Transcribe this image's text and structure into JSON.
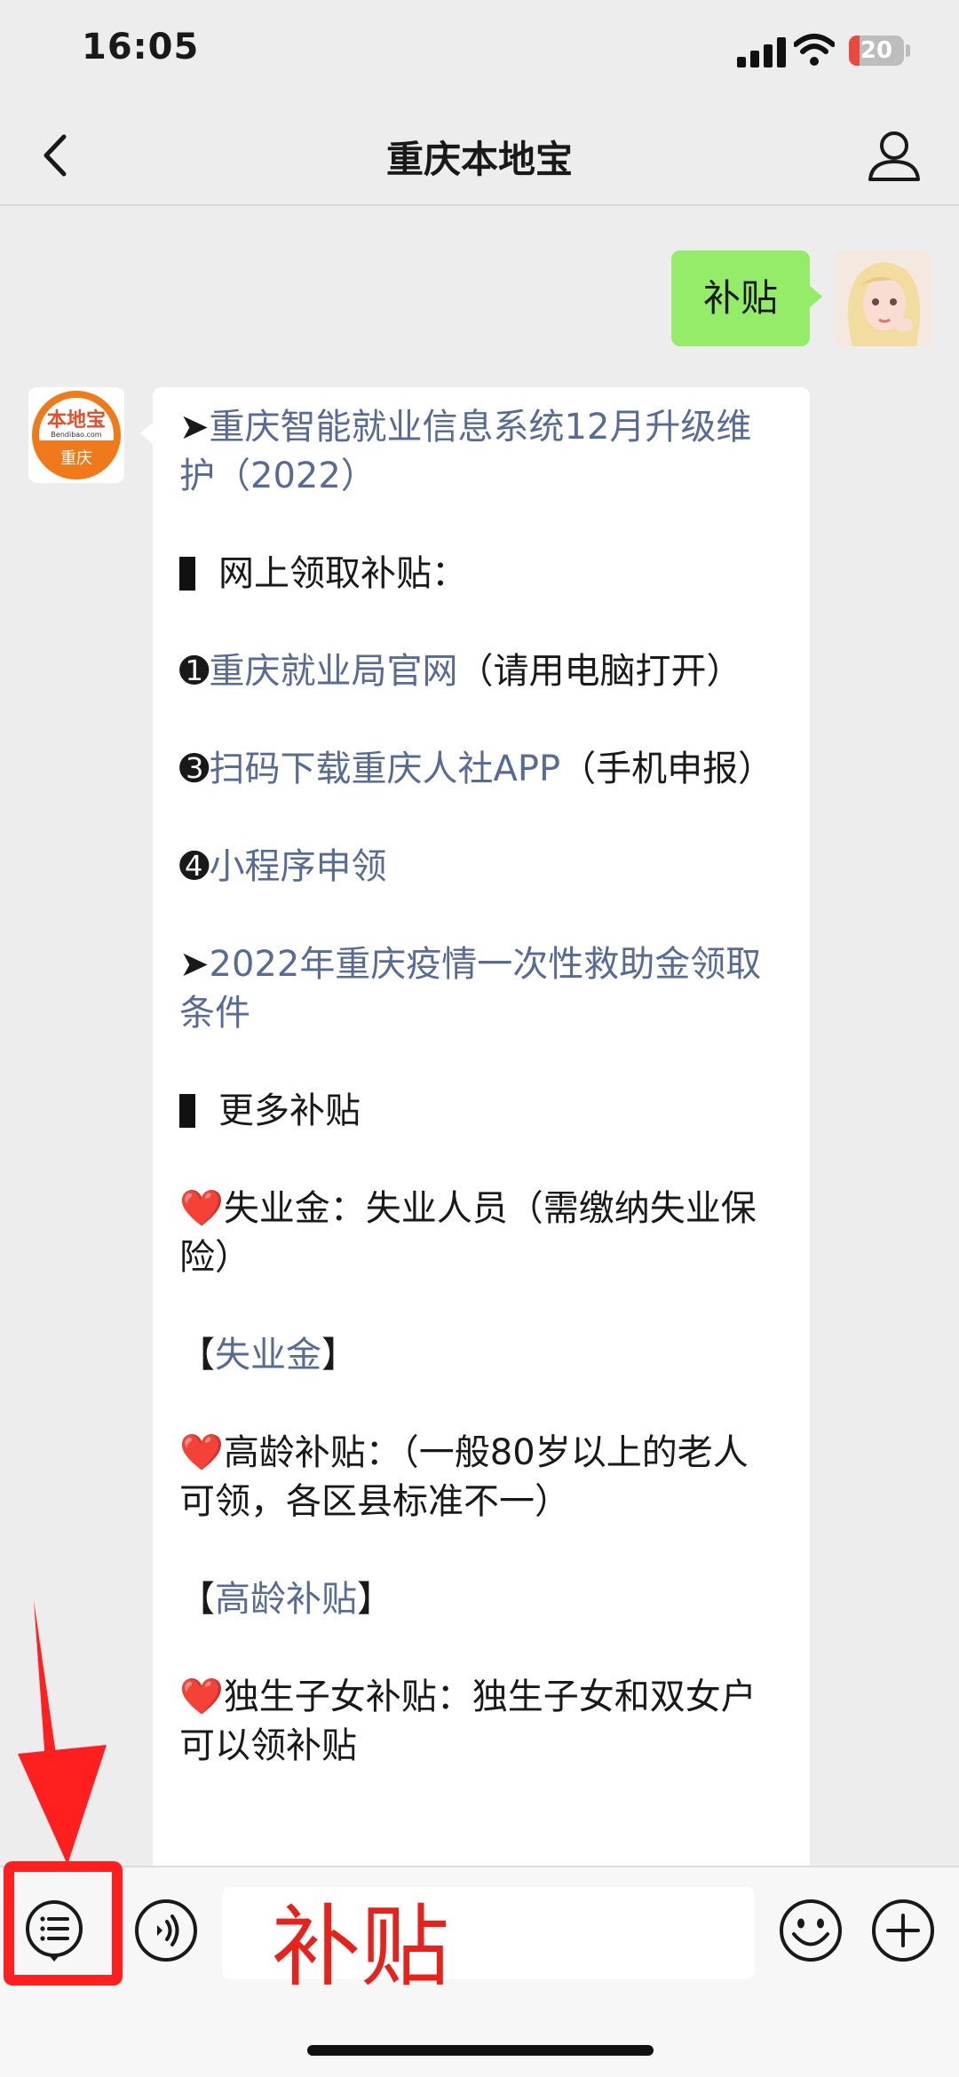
{
  "status_bar": {
    "time": "16:05",
    "battery_percent": "20",
    "battery_level": 0.2,
    "battery_color": "#e84a3b"
  },
  "nav": {
    "title": "重庆本地宝",
    "back_icon": "chevron-left-icon",
    "profile_icon": "person-icon"
  },
  "chat": {
    "user_message": "补贴",
    "bot_avatar": {
      "top_text": "本地宝",
      "domain_text": "Bendibao.com",
      "city_text": "重庆"
    },
    "bot_message": {
      "link1_prefix": "➤",
      "link1": "重庆智能就业信息系统12月升级维护（2022）",
      "section1": "网上领取补贴：",
      "item1_num": "➊",
      "item1_link": "重庆就业局官网",
      "item1_suffix": "（请用电脑打开）",
      "item3_num": "➌",
      "item3_link": "扫码下载重庆人社APP",
      "item3_suffix": "（手机申报）",
      "item4_num": "➍",
      "item4_link": "小程序申领",
      "link2_prefix": "➤",
      "link2": "2022年重庆疫情一次性救助金领取条件",
      "section2": "更多补贴",
      "heart": "❤️",
      "unemployment_text": "失业金：失业人员（需缴纳失业保险）",
      "unemployment_link": "失业金",
      "elderly_text": "高龄补贴：（一般80岁以上的老人可领，各区县标准不一）",
      "elderly_link": "高龄补贴",
      "onechild_text": "独生子女补贴：独生子女和双女户可以领补贴",
      "bracket_open": "【",
      "bracket_close": "】"
    }
  },
  "input_bar": {
    "text": "补贴",
    "menu_icon": "menu-list-icon",
    "voice_icon": "voice-icon",
    "emoji_icon": "smiley-icon",
    "plus_icon": "plus-icon"
  },
  "annotation": {
    "color": "#ff1f1f"
  }
}
